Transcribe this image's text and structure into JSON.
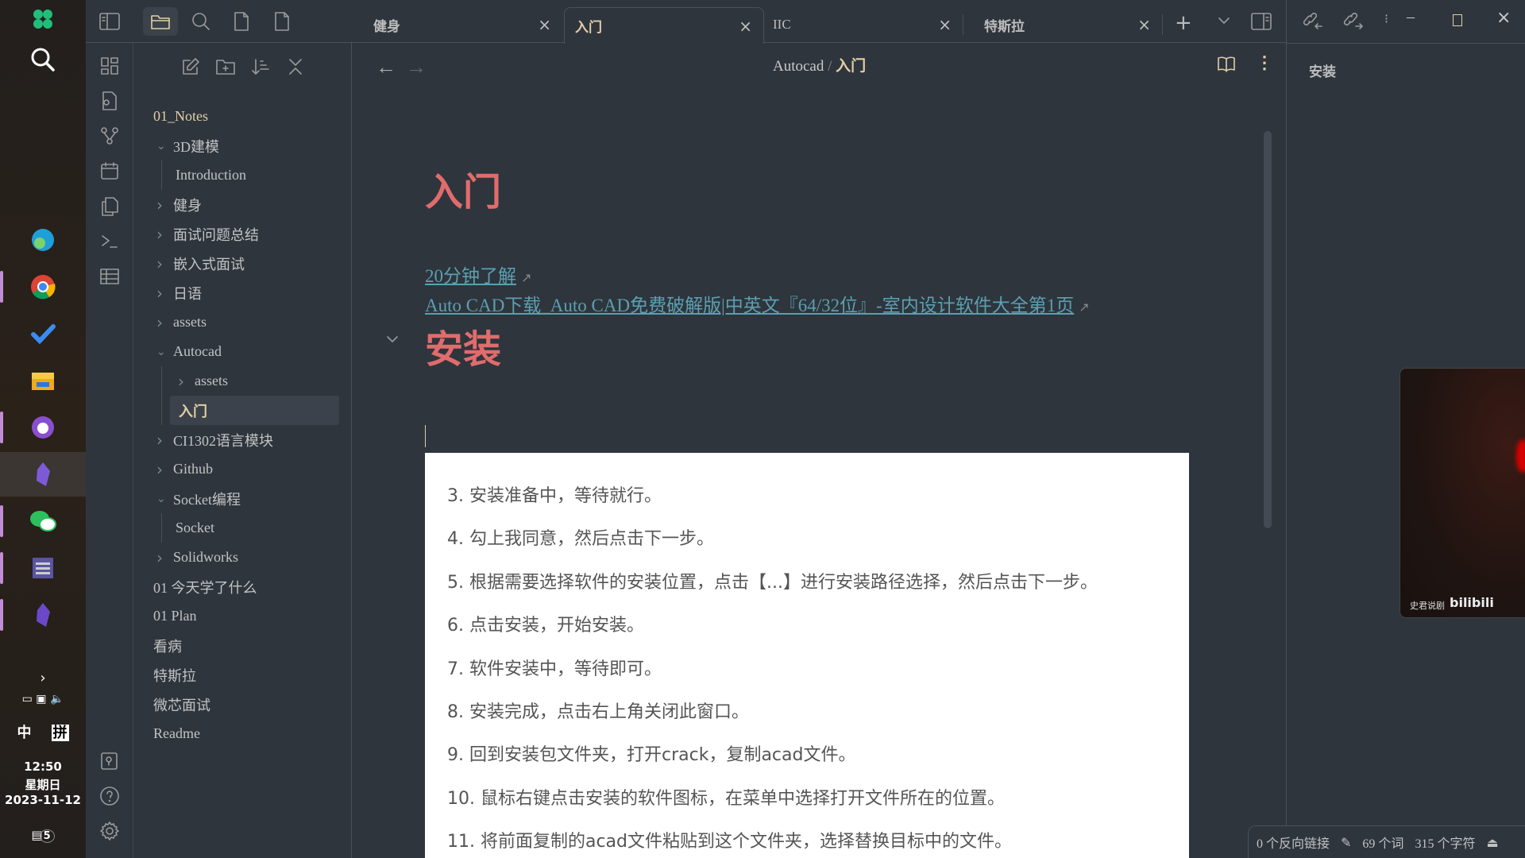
{
  "taskbar": {
    "time": "12:50",
    "weekday": "星期日",
    "date": "2023-11-12",
    "ime_lang": "中",
    "ime_mode": "拼",
    "notification_count": "5",
    "apps": [
      "clover",
      "search",
      "edge",
      "chrome",
      "todo",
      "file-explorer",
      "github-desktop",
      "obsidian",
      "wechat",
      "app",
      "obsidian"
    ]
  },
  "tabs": [
    {
      "label": "健身"
    },
    {
      "label": "入门",
      "active": true
    },
    {
      "label": "IIC"
    },
    {
      "label": "特斯拉"
    }
  ],
  "breadcrumb": {
    "parent": "Autocad",
    "sep": "/",
    "current": "入门"
  },
  "file_tree": [
    {
      "label": "01_Notes",
      "level": 0,
      "type": "root"
    },
    {
      "label": "3D建模",
      "level": 0,
      "type": "folder",
      "open": true
    },
    {
      "label": "Introduction",
      "level": 1,
      "type": "file"
    },
    {
      "label": "健身",
      "level": 0,
      "type": "folder"
    },
    {
      "label": "面试问题总结",
      "level": 0,
      "type": "folder"
    },
    {
      "label": "嵌入式面试",
      "level": 0,
      "type": "folder"
    },
    {
      "label": "日语",
      "level": 0,
      "type": "folder"
    },
    {
      "label": "assets",
      "level": 0,
      "type": "folder"
    },
    {
      "label": "Autocad",
      "level": 0,
      "type": "folder",
      "open": true
    },
    {
      "label": "assets",
      "level": 1,
      "type": "folder"
    },
    {
      "label": "入门",
      "level": 1,
      "type": "file",
      "selected": true
    },
    {
      "label": "CI1302语言模块",
      "level": 0,
      "type": "folder"
    },
    {
      "label": "Github",
      "level": 0,
      "type": "folder"
    },
    {
      "label": "Socket编程",
      "level": 0,
      "type": "folder",
      "open": true
    },
    {
      "label": "Socket",
      "level": 1,
      "type": "file"
    },
    {
      "label": "Solidworks",
      "level": 0,
      "type": "folder"
    },
    {
      "label": "01 今天学了什么",
      "level": 0,
      "type": "file"
    },
    {
      "label": "01 Plan",
      "level": 0,
      "type": "file"
    },
    {
      "label": "看病",
      "level": 0,
      "type": "file"
    },
    {
      "label": "特斯拉",
      "level": 0,
      "type": "file"
    },
    {
      "label": "微芯面试",
      "level": 0,
      "type": "file"
    },
    {
      "label": "Readme",
      "level": 0,
      "type": "file"
    }
  ],
  "note": {
    "title": "入门",
    "links": [
      "20分钟了解",
      "Auto CAD下载_Auto CAD免费破解版|中英文『64/32位』-室内设计软件大全第1页"
    ],
    "heading": "安装",
    "image_steps": [
      "3. 安装准备中，等待就行。",
      "4. 勾上我同意，然后点击下一步。",
      "5. 根据需要选择软件的安装位置，点击【...】进行安装路径选择，然后点击下一步。",
      "6. 点击安装，开始安装。",
      "7. 软件安装中，等待即可。",
      "8. 安装完成，点击右上角关闭此窗口。",
      "9. 回到安装包文件夹，打开crack，复制acad文件。",
      "10. 鼠标右键点击安装的软件图标，在菜单中选择打开文件所在的位置。",
      "11. 将前面复制的acad文件粘贴到这个文件夹，选择替换目标中的文件。"
    ]
  },
  "outline": {
    "items": [
      "安装"
    ]
  },
  "video_overlay": {
    "caption": "史君说剧",
    "brand": "bilibili"
  },
  "status_bar": {
    "backlinks": "0 个反向链接",
    "words": "69 个词",
    "chars": "315 个字符"
  },
  "colors": {
    "accent": "#e0cfa6",
    "heading": "#e06c6c",
    "link": "#5c9fb0",
    "background": "#2e353d"
  }
}
